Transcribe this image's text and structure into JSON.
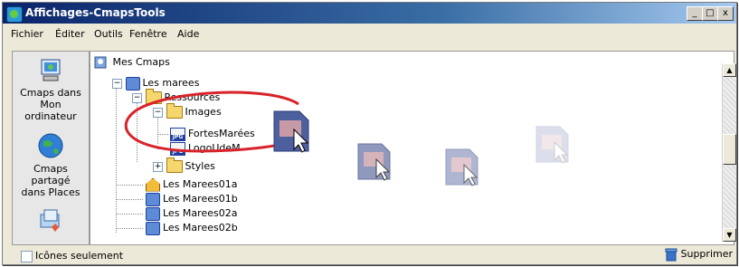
{
  "window": {
    "title": "Affichages-CmapsTools",
    "minimize": "_",
    "maximize": "□",
    "close": "x"
  },
  "menu": [
    "Fichier",
    "Éditer",
    "Outils",
    "Fenêtre",
    "Aide"
  ],
  "left_panel": {
    "items": [
      {
        "label1": "Cmaps dans",
        "label2": "Mon ordinateur",
        "icon": "computer-icon"
      },
      {
        "label1": "Cmaps partagé",
        "label2": "dans Places",
        "icon": "globe-icon"
      },
      {
        "label1": "",
        "label2": "",
        "icon": "shared-folder-icon"
      }
    ]
  },
  "tree": {
    "header": "Mes Cmaps",
    "rows": [
      {
        "label": "Les marees",
        "icon": "cmap-icon",
        "toggle": "−"
      },
      {
        "label": "Ressources",
        "icon": "folder-icon",
        "toggle": "−"
      },
      {
        "label": "Images",
        "icon": "folder-icon",
        "toggle": "−"
      },
      {
        "label": "FortesMarées",
        "icon": "jpg-icon"
      },
      {
        "label": "LogoUdeM",
        "icon": "jpg-icon"
      },
      {
        "label": "Styles",
        "icon": "folder-icon",
        "toggle": "+"
      },
      {
        "label": "Les Marees01a",
        "icon": "house-icon"
      },
      {
        "label": "Les Marees01b",
        "icon": "cmap-icon"
      },
      {
        "label": "Les Marees02a",
        "icon": "cmap-icon"
      },
      {
        "label": "Les Marees02b",
        "icon": "cmap-icon"
      }
    ]
  },
  "footer": {
    "checkbox_label": "Icônes seulement",
    "delete_label": "Supprimer"
  },
  "colors": {
    "annotation_red": "#d8232a",
    "title_start": "#0a246a",
    "title_end": "#a6caf0"
  }
}
